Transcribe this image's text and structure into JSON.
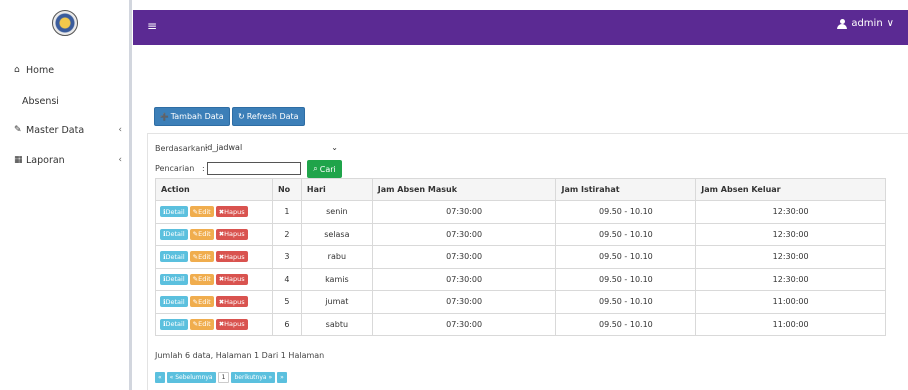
{
  "sidebar": {
    "items": [
      {
        "icon": "home-icon",
        "glyph": "⌂",
        "label": "Home"
      },
      {
        "icon": "",
        "glyph": "",
        "label": "Absensi"
      },
      {
        "icon": "edit-icon",
        "glyph": "✎",
        "label": "Master Data"
      },
      {
        "icon": "calendar-icon",
        "glyph": "▦",
        "label": "Laporan"
      }
    ],
    "chevron": "‹"
  },
  "header": {
    "menu_glyph": "≡",
    "user_label": "admin",
    "user_caret": "∨"
  },
  "toolbar": {
    "tambah_label": "Tambah Data",
    "refresh_label": "Refresh Data",
    "tambah_glyph": "➕",
    "refresh_glyph": "↻"
  },
  "filter": {
    "berdasarkan_label": "Berdasarkan:",
    "select_value": "id_jadwal",
    "select_caret": "⌄",
    "pencarian_label": "Pencarian",
    "pencarian_colon": ":",
    "search_value": "",
    "cari_label": "Cari",
    "cari_glyph": "⌕"
  },
  "table": {
    "headers": [
      "Action",
      "No",
      "Hari",
      "Jam Absen Masuk",
      "Jam Istirahat",
      "Jam Absen Keluar"
    ],
    "action_labels": {
      "detail": "Detail",
      "edit": "Edit",
      "hapus": "Hapus"
    },
    "action_glyphs": {
      "detail": "ℹ",
      "edit": "✎",
      "hapus": "✖"
    },
    "rows": [
      {
        "no": "1",
        "hari": "senin",
        "masuk": "07:30:00",
        "istirahat": "09.50 - 10.10",
        "keluar": "12:30:00"
      },
      {
        "no": "2",
        "hari": "selasa",
        "masuk": "07:30:00",
        "istirahat": "09.50 - 10.10",
        "keluar": "12:30:00"
      },
      {
        "no": "3",
        "hari": "rabu",
        "masuk": "07:30:00",
        "istirahat": "09.50 - 10.10",
        "keluar": "12:30:00"
      },
      {
        "no": "4",
        "hari": "kamis",
        "masuk": "07:30:00",
        "istirahat": "09.50 - 10.10",
        "keluar": "12:30:00"
      },
      {
        "no": "5",
        "hari": "jumat",
        "masuk": "07:30:00",
        "istirahat": "09.50 - 10.10",
        "keluar": "11:00:00"
      },
      {
        "no": "6",
        "hari": "sabtu",
        "masuk": "07:30:00",
        "istirahat": "09.50 - 10.10",
        "keluar": "11:00:00"
      }
    ]
  },
  "summary": "Jumlah 6 data, Halaman 1 Dari 1 Halaman",
  "pagination": {
    "first": "«",
    "prev": "« Sebelumnya",
    "current": "1",
    "next": "berikutnya »",
    "last": "»"
  },
  "colors": {
    "topbar": "#5b2a93",
    "primary": "#3c7fb8",
    "success": "#1fa44a",
    "info": "#5bc0de",
    "warning": "#f0ad4e",
    "danger": "#d9534f"
  }
}
